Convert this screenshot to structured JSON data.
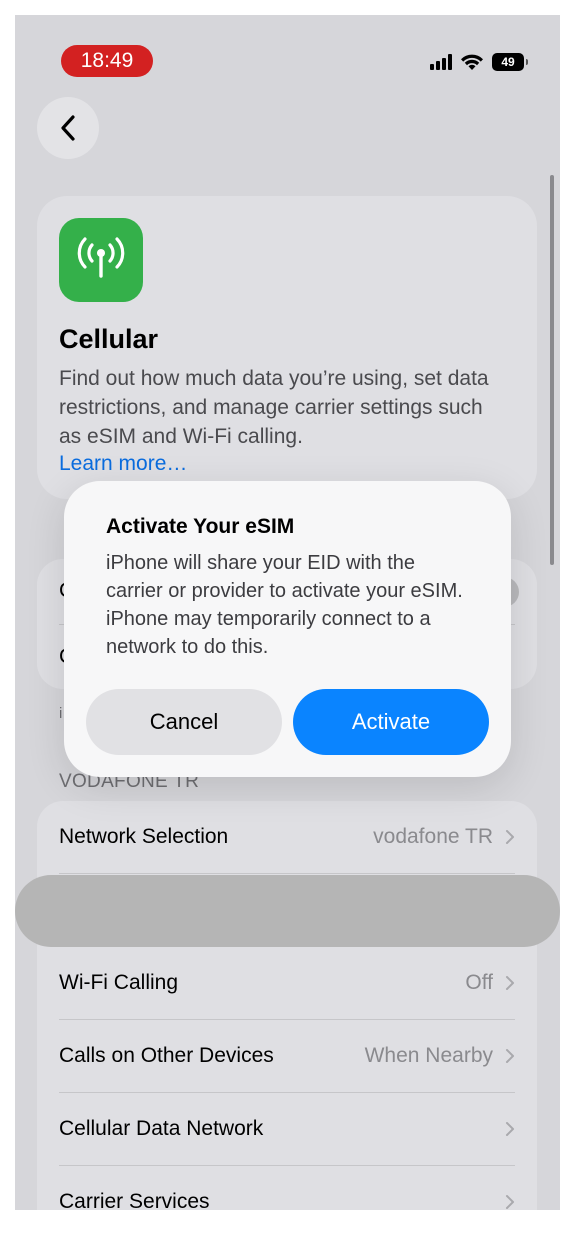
{
  "status_bar": {
    "time": "18:49",
    "battery_level": "49",
    "time_pill_color": "#d32121",
    "icons": [
      "signal-icon",
      "wifi-icon",
      "battery-icon"
    ]
  },
  "nav": {
    "back_icon": "chevron-left-icon"
  },
  "header_card": {
    "icon": "antenna-icon",
    "icon_color": "#34b04a",
    "title": "Cellular",
    "description": "Find out how much data you’re using, set data restrictions, and manage carrier settings such as eSIM and Wi-Fi calling.",
    "link": "Learn more…"
  },
  "obscured": {
    "row1_fragment": "C",
    "row2_fragment": "C",
    "footnote_fragment": "i"
  },
  "section_header": "VODAFONE TR",
  "rows": [
    {
      "label": "Network Selection",
      "value": "vodafone TR"
    },
    {
      "label": "",
      "value": ""
    },
    {
      "label": "Wi-Fi Calling",
      "value": "Off"
    },
    {
      "label": "Calls on Other Devices",
      "value": "When Nearby"
    },
    {
      "label": "Cellular Data Network",
      "value": ""
    },
    {
      "label": "Carrier Services",
      "value": ""
    }
  ],
  "alert": {
    "title": "Activate Your eSIM",
    "message": "iPhone will share your EID with the carrier or provider to activate your eSIM. iPhone may temporarily connect to a network to do this.",
    "cancel_label": "Cancel",
    "activate_label": "Activate",
    "accent_color": "#0a84ff"
  }
}
